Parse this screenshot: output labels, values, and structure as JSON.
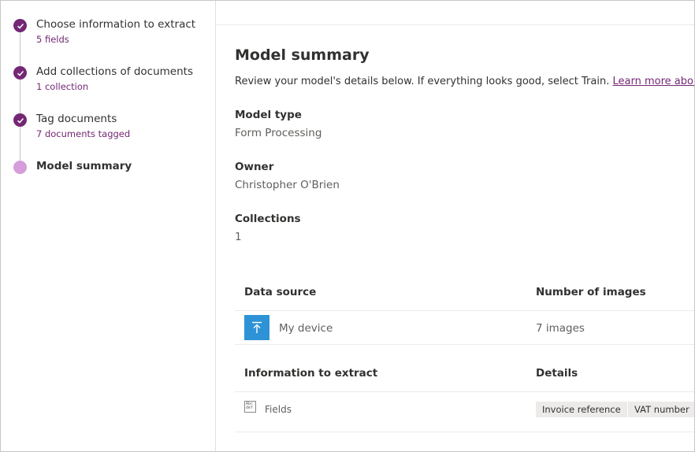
{
  "stepper": {
    "steps": [
      {
        "title": "Choose information to extract",
        "subtitle": "5 fields",
        "status": "complete"
      },
      {
        "title": "Add collections of documents",
        "subtitle": "1 collection",
        "status": "complete"
      },
      {
        "title": "Tag documents",
        "subtitle": "7 documents tagged",
        "status": "complete"
      },
      {
        "title": "Model summary",
        "subtitle": "",
        "status": "current"
      }
    ]
  },
  "summary": {
    "title": "Model summary",
    "description": "Review your model's details below. If everything looks good, select Train. ",
    "learn_more_link": "Learn more about training"
  },
  "details": {
    "model_type_label": "Model type",
    "model_type_value": "Form Processing",
    "owner_label": "Owner",
    "owner_value": "Christopher O'Brien",
    "collections_label": "Collections",
    "collections_value": "1"
  },
  "data_source_table": {
    "headers": [
      "Data source",
      "Number of images"
    ],
    "rows": [
      {
        "source": "My device",
        "icon": "upload-icon",
        "count": "7 images"
      }
    ]
  },
  "extract_table": {
    "headers": [
      "Information to extract",
      "Details"
    ],
    "rows": [
      {
        "name": "Fields",
        "icon": "fields-icon",
        "tags": [
          "Invoice reference",
          "VAT number"
        ]
      }
    ]
  },
  "colors": {
    "accent": "#742774",
    "current_step": "#d59dd9",
    "upload_tile": "#2e93d6"
  }
}
